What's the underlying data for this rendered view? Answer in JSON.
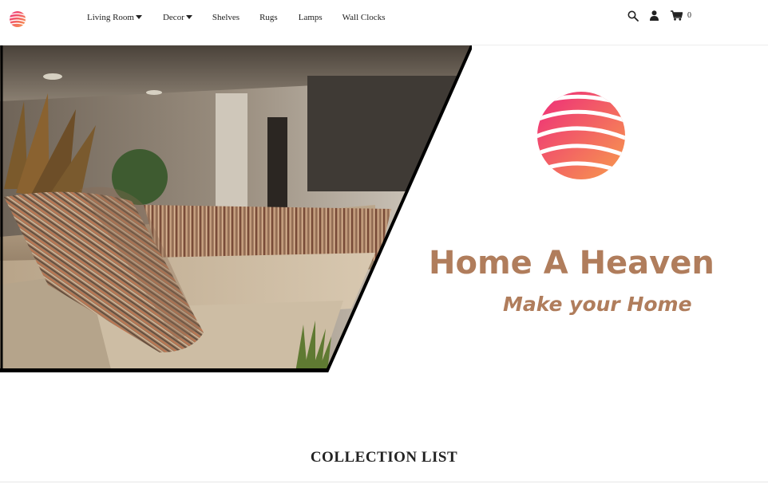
{
  "header": {
    "nav": [
      {
        "label": "Living Room",
        "has_dropdown": true
      },
      {
        "label": "Decor",
        "has_dropdown": true
      },
      {
        "label": "Shelves",
        "has_dropdown": false
      },
      {
        "label": "Rugs",
        "has_dropdown": false
      },
      {
        "label": "Lamps",
        "has_dropdown": false
      },
      {
        "label": "Wall Clocks",
        "has_dropdown": false
      }
    ],
    "icons": [
      "search-icon",
      "user-icon",
      "cart-icon"
    ],
    "cart_count": "0"
  },
  "hero": {
    "brand_name": "Home A Heaven",
    "tagline": "Make your Home"
  },
  "collection": {
    "title": "COLLECTION LIST"
  },
  "colors": {
    "brand_text": "#b07d5c",
    "logo_gradient_start": "#ee2a7b",
    "logo_gradient_end": "#f79c4c"
  }
}
